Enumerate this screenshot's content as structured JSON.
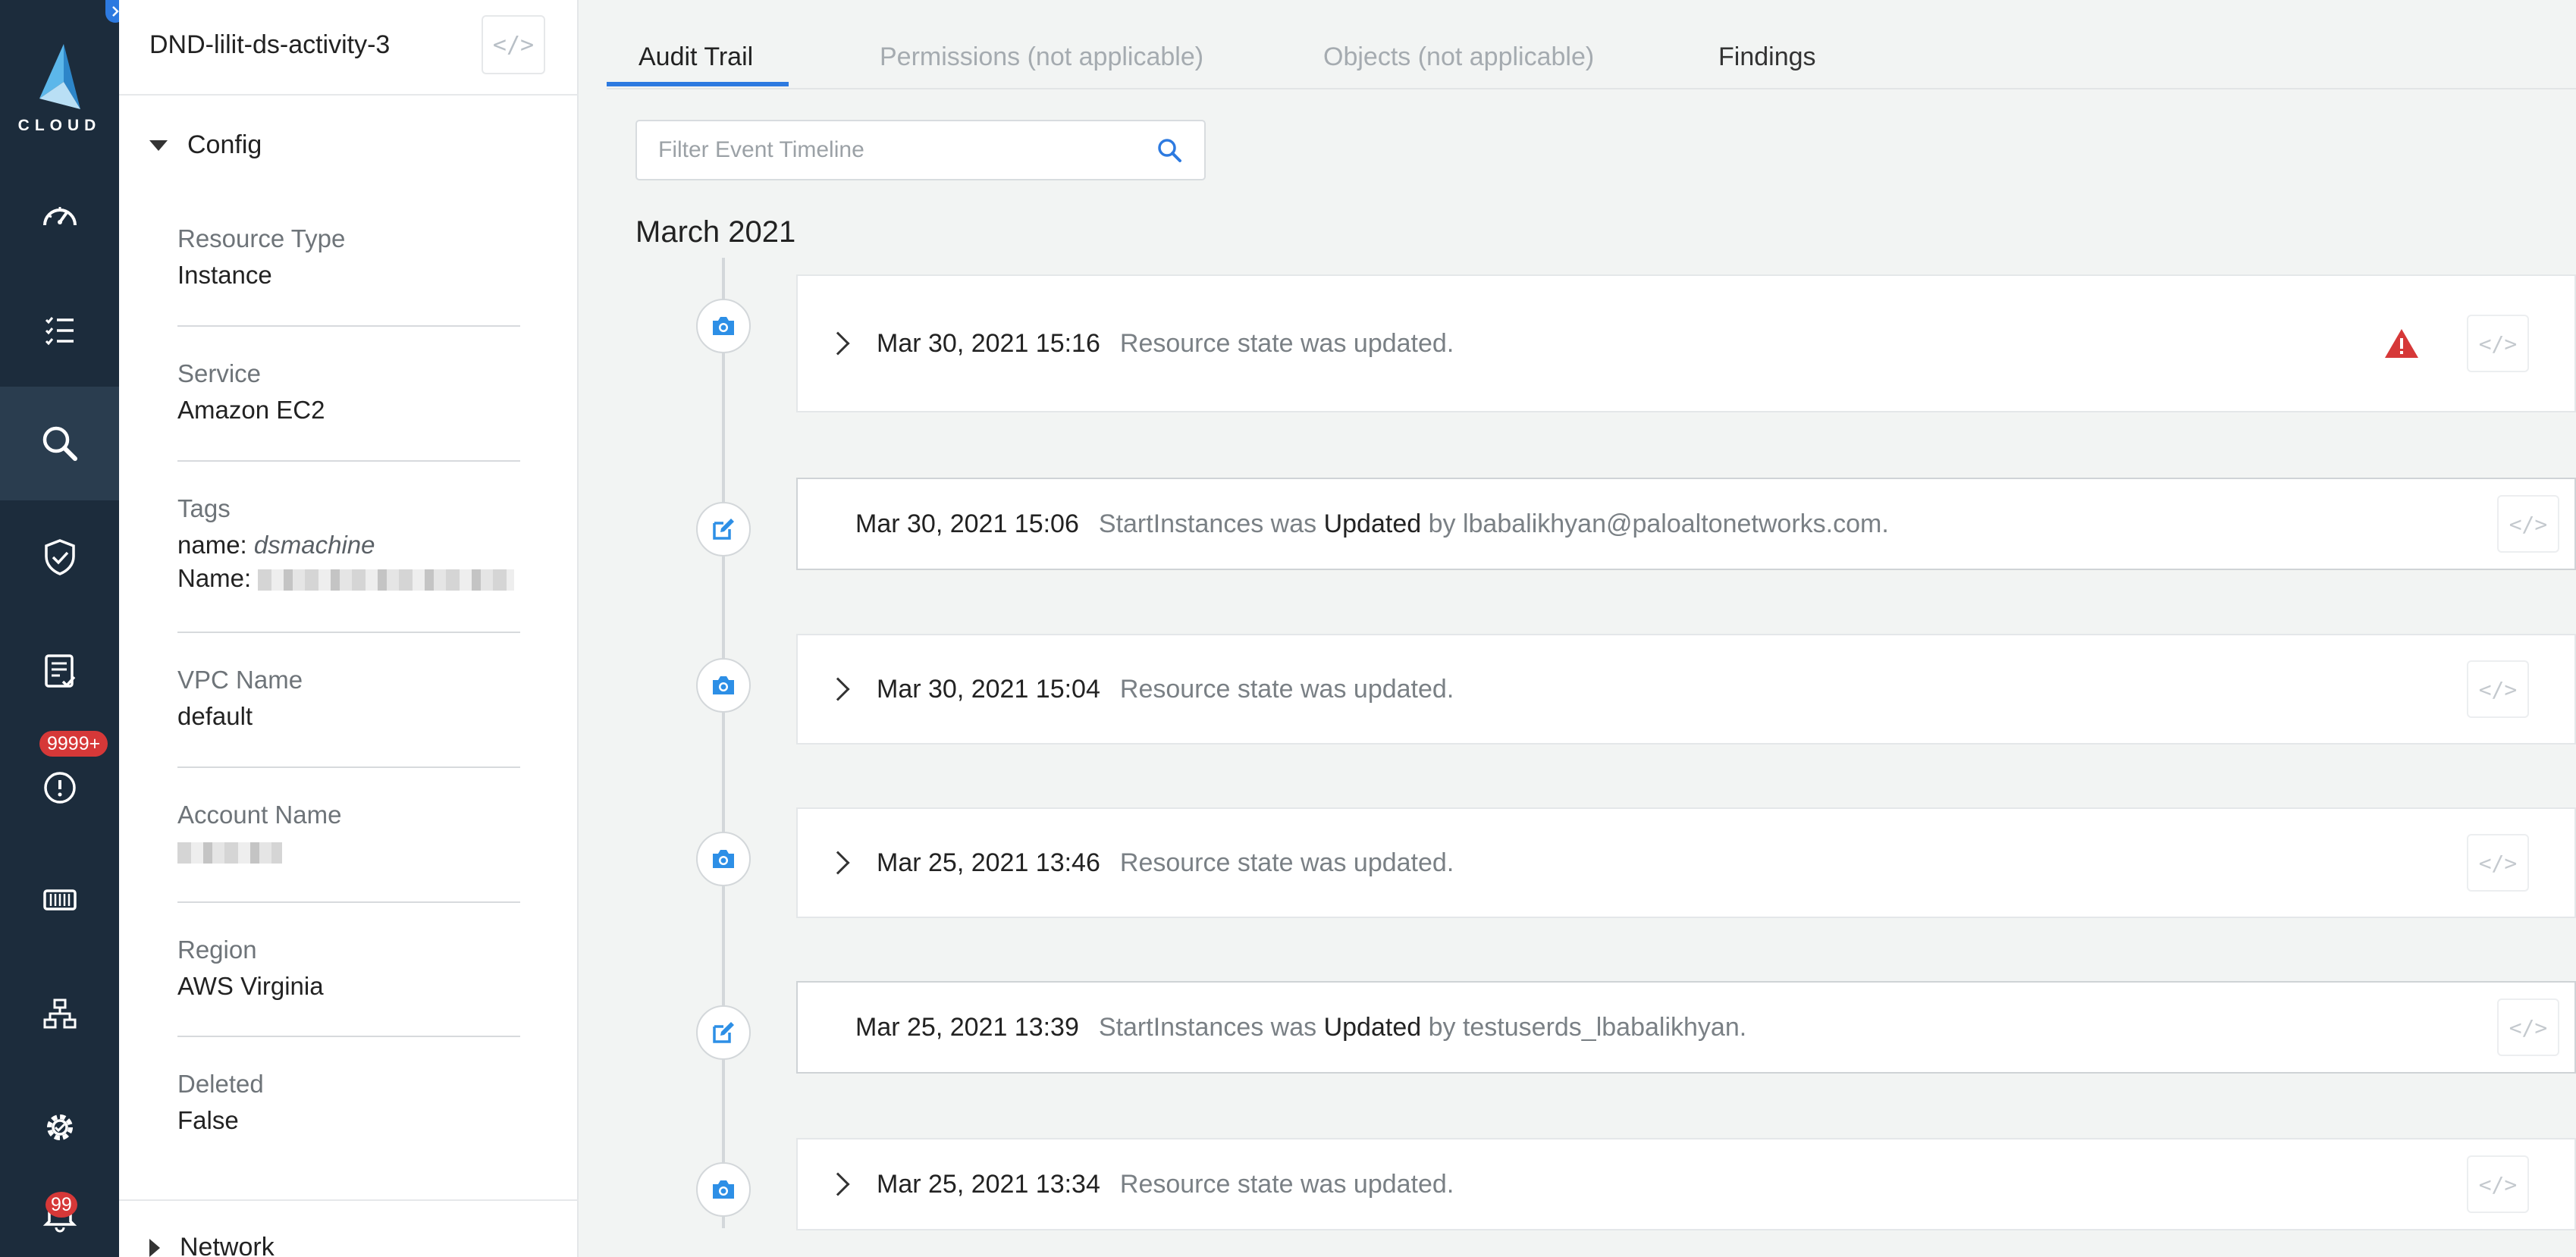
{
  "nav": {
    "logo_text": "CLOUD",
    "items": [
      {
        "icon": "dashboard-gauge-icon"
      },
      {
        "icon": "checklist-icon"
      },
      {
        "icon": "search-icon",
        "active": true
      },
      {
        "icon": "shield-check-icon"
      },
      {
        "icon": "compliance-report-icon"
      },
      {
        "icon": "alert-icon",
        "badge": "9999+"
      },
      {
        "icon": "compute-container-icon"
      },
      {
        "icon": "network-topology-icon"
      },
      {
        "icon": "settings-gear-icon"
      },
      {
        "icon": "notification-bell-icon",
        "badge": "99"
      }
    ]
  },
  "panel": {
    "title": "DND-lilit-ds-activity-3",
    "code_button": "</>",
    "config_label": "Config",
    "fields": {
      "resource_type": {
        "label": "Resource Type",
        "value": "Instance"
      },
      "service": {
        "label": "Service",
        "value": "Amazon EC2"
      },
      "tags": {
        "label": "Tags",
        "tag1_key": "name:",
        "tag1_value": "dsmachine",
        "tag2_key": "Name:"
      },
      "vpc_name": {
        "label": "VPC Name",
        "value": "default"
      },
      "account_name": {
        "label": "Account Name"
      },
      "region": {
        "label": "Region",
        "value": "AWS Virginia"
      },
      "deleted": {
        "label": "Deleted",
        "value": "False"
      }
    },
    "network_label": "Network"
  },
  "tabs": {
    "audit_trail": "Audit Trail",
    "permissions": "Permissions (not applicable)",
    "objects": "Objects (not applicable)",
    "findings": "Findings"
  },
  "search": {
    "placeholder": "Filter Event Timeline"
  },
  "timeline": {
    "month": "March 2021",
    "events": [
      {
        "type": "snapshot",
        "date": "Mar 30, 2021 15:16",
        "desc": "Resource state was updated."
      },
      {
        "type": "edit",
        "date": "Mar 30, 2021 15:06",
        "desc_pre": "StartInstances was",
        "desc_action": "Updated",
        "desc_post": "by lbabalikhyan@paloaltonetworks.com."
      },
      {
        "type": "snapshot",
        "date": "Mar 30, 2021 15:04",
        "desc": "Resource state was updated."
      },
      {
        "type": "snapshot",
        "date": "Mar 25, 2021 13:46",
        "desc": "Resource state was updated."
      },
      {
        "type": "edit",
        "date": "Mar 25, 2021 13:39",
        "desc_pre": "StartInstances was",
        "desc_action": "Updated",
        "desc_post": "by testuserds_lbabalikhyan."
      },
      {
        "type": "snapshot",
        "date": "Mar 25, 2021 13:34",
        "desc": "Resource state was updated."
      }
    ]
  },
  "colors": {
    "accent": "#2d7ae0",
    "nav_bg": "#1c2c3c",
    "warning": "#d63838"
  }
}
